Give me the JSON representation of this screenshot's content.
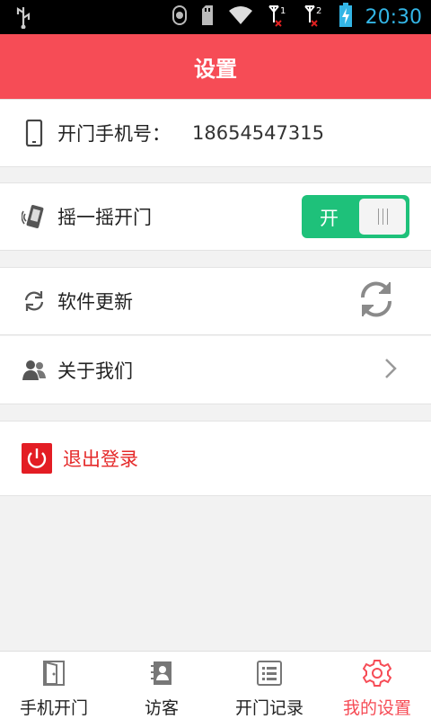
{
  "status_bar": {
    "time": "20:30",
    "sim1": "1",
    "sim2": "2"
  },
  "header": {
    "title": "设置"
  },
  "phone_row": {
    "label": "开门手机号：",
    "value": "18654547315"
  },
  "shake_row": {
    "label": "摇一摇开门",
    "toggle_text": "开",
    "toggle_on": true
  },
  "update_row": {
    "label": "软件更新"
  },
  "about_row": {
    "label": "关于我们"
  },
  "logout_row": {
    "label": "退出登录"
  },
  "tabs": [
    {
      "label": "手机开门",
      "icon": "door-icon",
      "active": false
    },
    {
      "label": "访客",
      "icon": "contacts-icon",
      "active": false
    },
    {
      "label": "开门记录",
      "icon": "list-icon",
      "active": false
    },
    {
      "label": "我的设置",
      "icon": "gear-icon",
      "active": true
    }
  ],
  "colors": {
    "accent": "#f64c56",
    "toggle_green": "#1ec17a",
    "logout_red": "#e31d24",
    "time_blue": "#33b5e5"
  }
}
